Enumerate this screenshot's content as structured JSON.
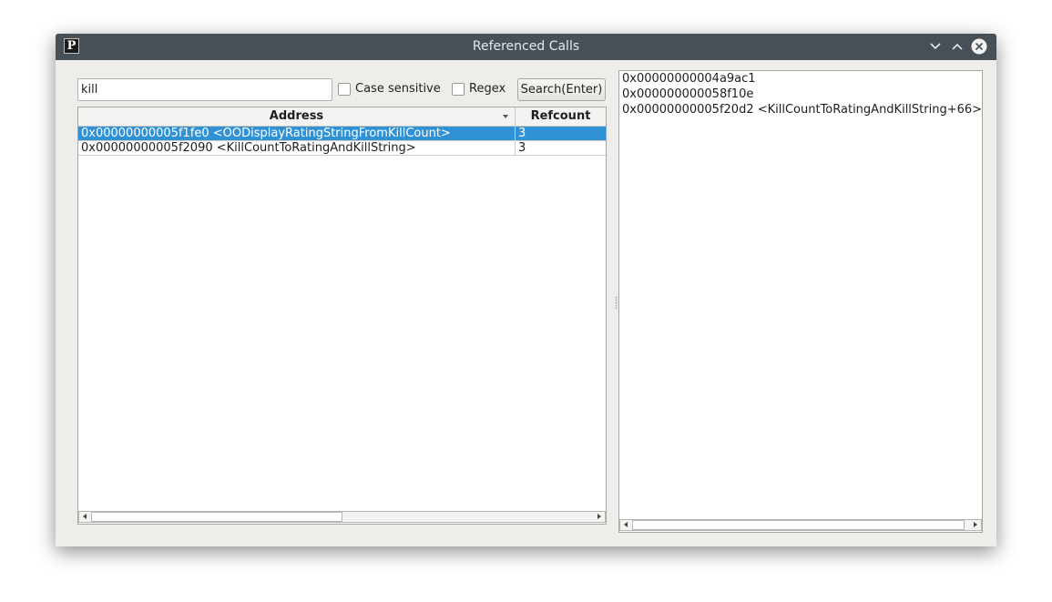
{
  "window": {
    "title": "Referenced Calls",
    "app_icon_letter": "P"
  },
  "search": {
    "value": "kill",
    "case_sensitive_label": "Case sensitive",
    "case_sensitive_checked": false,
    "regex_label": "Regex",
    "regex_checked": false,
    "button_label": "Search(Enter)"
  },
  "table": {
    "columns": [
      "Address",
      "Refcount"
    ],
    "sort_column": "Address",
    "sort_direction": "descending",
    "rows": [
      {
        "address": "0x00000000005f1fe0 <OODisplayRatingStringFromKillCount>",
        "refcount": "3",
        "selected": true
      },
      {
        "address": "0x00000000005f2090 <KillCountToRatingAndKillString>",
        "refcount": "3",
        "selected": false
      }
    ]
  },
  "references": [
    "0x00000000004a9ac1",
    "0x000000000058f10e",
    "0x00000000005f20d2 <KillCountToRatingAndKillString+66>"
  ],
  "icons": {
    "minimize": "chevron-down-icon",
    "maximize": "chevron-up-icon",
    "close": "close-circle-icon"
  },
  "colors": {
    "titlebar": "#475057",
    "selection": "#3191d5",
    "window_bg": "#efedea"
  }
}
